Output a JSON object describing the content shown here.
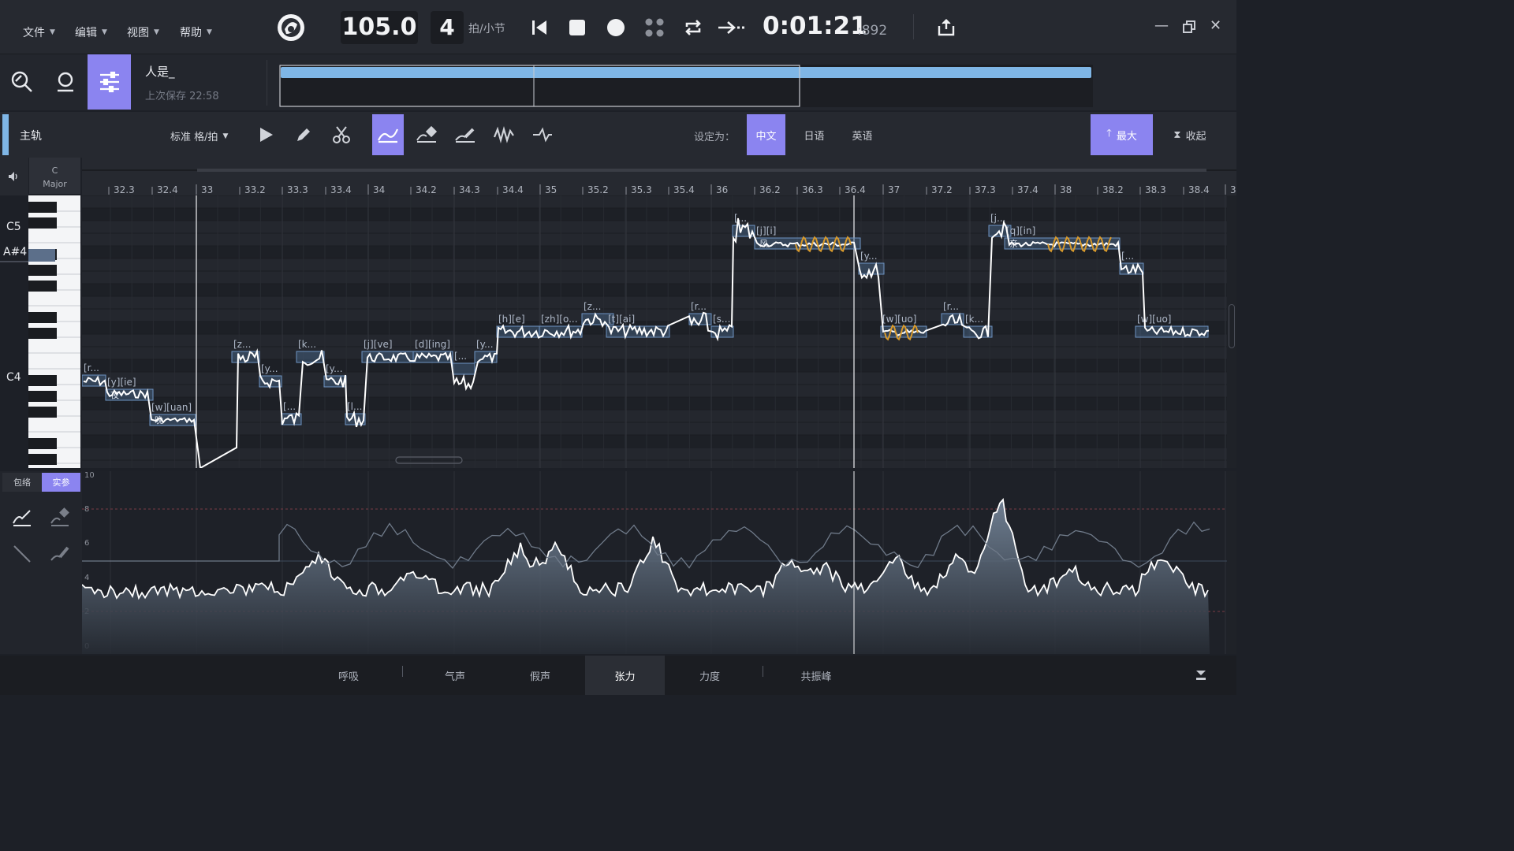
{
  "menu": {
    "file": "文件",
    "edit": "编辑",
    "view": "视图",
    "help": "帮助"
  },
  "transport": {
    "tempo": "105.0",
    "beats": "4",
    "beats_unit": "拍/小节",
    "time_main": "0:01:21",
    "time_ms": ":892"
  },
  "project": {
    "name": "人是_",
    "saved": "上次保存 22:58"
  },
  "track": {
    "name": "主轨",
    "quantize": "标准 格/拍",
    "set_as": "设定为：",
    "languages": [
      "中文",
      "日语",
      "英语"
    ],
    "active_language": "中文",
    "maximize": "最大",
    "collapse": "收起"
  },
  "key": {
    "root": "C",
    "mode": "Major"
  },
  "piano_labels": [
    "C5",
    "A#4",
    "C4"
  ],
  "ruler_labels": [
    "32.3",
    "32.4",
    "33",
    "33.2",
    "33.3",
    "33.4",
    "34",
    "34.2",
    "34.3",
    "34.4",
    "35",
    "35.2",
    "35.3",
    "35.4",
    "36",
    "36.2",
    "36.3",
    "36.4",
    "37",
    "37.2",
    "37.3",
    "37.4",
    "38",
    "38.2",
    "38.3",
    "38.4",
    "3"
  ],
  "notes": [
    {
      "label": "[r...",
      "lyric": ""
    },
    {
      "label": "[y][ie]",
      "lyric": "夜"
    },
    {
      "label": "[w][uan]",
      "lyric": "晚"
    },
    {
      "label": "[z...",
      "lyric": ""
    },
    {
      "label": "[y...",
      "lyric": ""
    },
    {
      "label": "[...",
      "lyric": ""
    },
    {
      "label": "[k...",
      "lyric": ""
    },
    {
      "label": "[y...",
      "lyric": ""
    },
    {
      "label": "[l...",
      "lyric": ""
    },
    {
      "label": "[j][ve]",
      "lyric": ""
    },
    {
      "label": "[d][ing]",
      "lyric": ""
    },
    {
      "label": "[...",
      "lyric": ""
    },
    {
      "label": "[y...",
      "lyric": ""
    },
    {
      "label": "[h][e]",
      "lyric": ""
    },
    {
      "label": "[zh][o...",
      "lyric": ""
    },
    {
      "label": "[z...",
      "lyric": ""
    },
    {
      "label": "[t][ai]",
      "lyric": ""
    },
    {
      "label": "[r...",
      "lyric": ""
    },
    {
      "label": "[s...",
      "lyric": ""
    },
    {
      "label": "[...",
      "lyric": ""
    },
    {
      "label": "[j][i]",
      "lyric": "风"
    },
    {
      "label": "[y...",
      "lyric": ""
    },
    {
      "label": "[w][uo]",
      "lyric": ""
    },
    {
      "label": "[r...",
      "lyric": ""
    },
    {
      "label": "[k...",
      "lyric": ""
    },
    {
      "label": "[j...",
      "lyric": ""
    },
    {
      "label": "[q][in]",
      "lyric": "亲"
    },
    {
      "label": "[...",
      "lyric": ""
    },
    {
      "label": "[w][uo]",
      "lyric": ""
    }
  ],
  "param_mode": {
    "envelope": "包络",
    "real": "实参"
  },
  "param_scale": [
    "10",
    "8",
    "6",
    "4",
    "2",
    "0"
  ],
  "param_tabs": [
    "呼吸",
    "气声",
    "假声",
    "张力",
    "力度",
    "共振峰"
  ],
  "active_param_tab": "张力",
  "colors": {
    "accent": "#8b84f0",
    "overview_bar": "#7fb6e6",
    "note_box": "#4b6a8f",
    "pitch_line": "#ffffff",
    "vibrato": "#d89a2c"
  }
}
